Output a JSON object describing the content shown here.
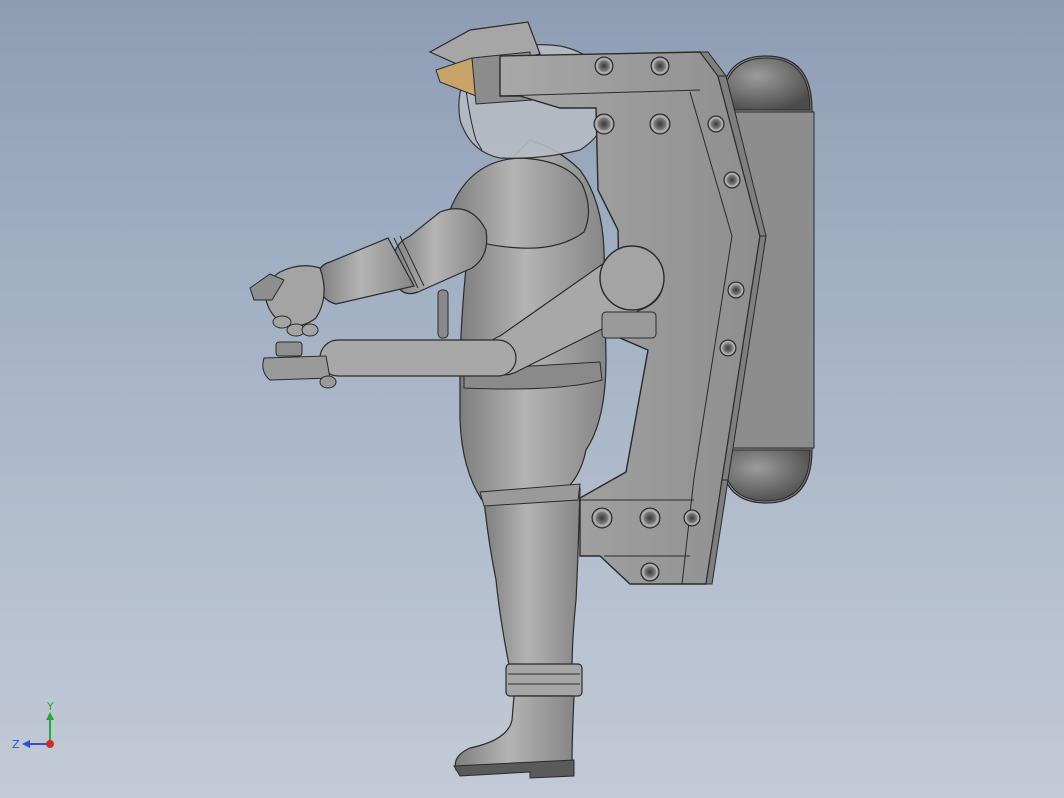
{
  "viewport": {
    "background_top": "#8e9db4",
    "background_bottom": "#c3cad6",
    "model_color": "#9b9b9b",
    "edge_color": "#2a2a2a",
    "visor_tint": "#c9a46a"
  },
  "triad": {
    "y_label": "Y",
    "z_label": "Z",
    "y_color": "#1fae2f",
    "z_color": "#2b4fd6",
    "x_color": "#d62b2b"
  }
}
